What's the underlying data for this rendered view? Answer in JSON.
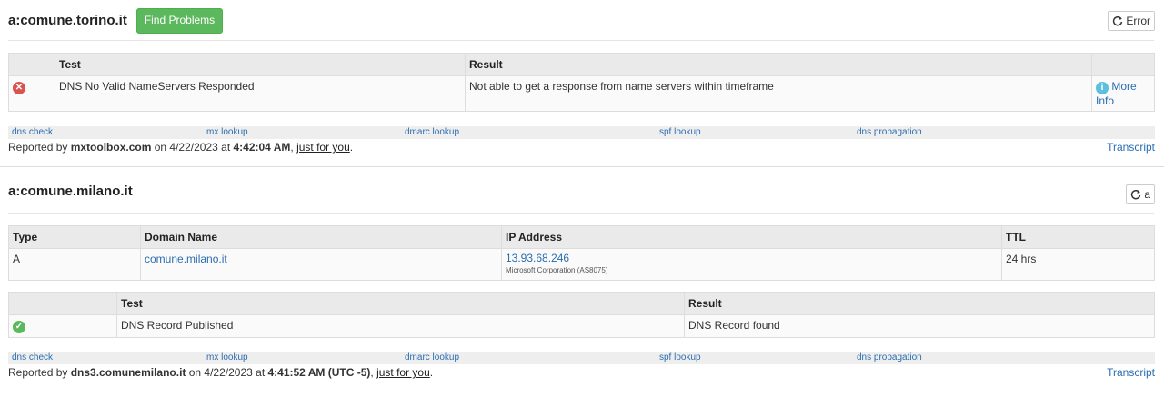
{
  "section1": {
    "title": "a:comune.torino.it",
    "find_button": "Find Problems",
    "status_button": "Error",
    "table": {
      "headers": [
        "",
        "Test",
        "Result",
        ""
      ],
      "row": {
        "test": "DNS No Valid NameServers Responded",
        "result": "Not able to get a response from name servers within timeframe",
        "more_info": "More Info"
      }
    },
    "links": [
      "dns check",
      "mx lookup",
      "dmarc lookup",
      "spf lookup",
      "dns propagation"
    ],
    "reported": {
      "prefix": "Reported by ",
      "server": "mxtoolbox.com",
      "on": " on 4/22/2023 at ",
      "time": "4:42:04 AM",
      "comma": ", ",
      "just": "just for you",
      "period": ".",
      "transcript": "Transcript"
    }
  },
  "section2": {
    "title": "a:comune.milano.it",
    "status_button": "a",
    "record_table": {
      "headers": [
        "Type",
        "Domain Name",
        "IP Address",
        "TTL"
      ],
      "row": {
        "type": "A",
        "domain": "comune.milano.it",
        "ip": "13.93.68.246",
        "ip_owner": "Microsoft Corporation (AS8075)",
        "ttl": "24 hrs"
      }
    },
    "test_table": {
      "headers": [
        "",
        "Test",
        "Result"
      ],
      "row": {
        "test": "DNS Record Published",
        "result": "DNS Record found"
      }
    },
    "links": [
      "dns check",
      "mx lookup",
      "dmarc lookup",
      "spf lookup",
      "dns propagation"
    ],
    "reported": {
      "prefix": "Reported by ",
      "server": "dns3.comunemilano.it",
      "on": " on 4/22/2023 at ",
      "time": "4:41:52 AM (UTC -5)",
      "comma": ", ",
      "just": "just for you",
      "period": ".",
      "transcript": "Transcript"
    }
  },
  "colors": {
    "accent": "#2a6db0",
    "success": "#5cb85c",
    "error": "#d9534f",
    "info": "#5bc0de"
  }
}
